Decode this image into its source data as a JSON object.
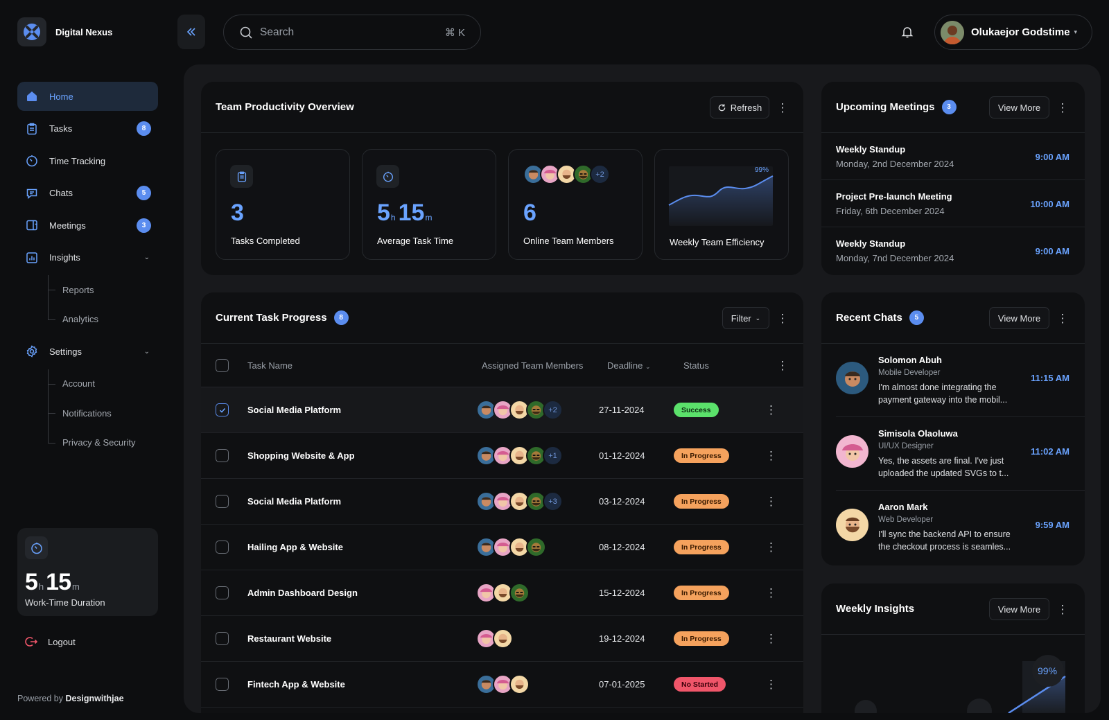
{
  "app": {
    "name": "Digital Nexus"
  },
  "sidebar": {
    "items": [
      {
        "label": "Home",
        "badge": ""
      },
      {
        "label": "Tasks",
        "badge": "8"
      },
      {
        "label": "Time Tracking",
        "badge": ""
      },
      {
        "label": "Chats",
        "badge": "5"
      },
      {
        "label": "Meetings",
        "badge": "3"
      },
      {
        "label": "Insights",
        "badge": ""
      },
      {
        "label": "Settings",
        "badge": ""
      }
    ],
    "insights_sub": [
      "Reports",
      "Analytics"
    ],
    "settings_sub": [
      "Account",
      "Notifications",
      "Privacy & Security"
    ],
    "worktime": {
      "hours": "5",
      "h_unit": "h",
      "minutes": "15",
      "m_unit": "m",
      "label": "Work-Time Duration"
    },
    "logout": "Logout",
    "powered_prefix": "Powered by ",
    "powered_brand": "Designwithjae"
  },
  "search": {
    "placeholder": "Search",
    "shortcut": "⌘ K"
  },
  "user": {
    "name": "Olukaejor Godstime"
  },
  "productivity": {
    "title": "Team Productivity Overview",
    "refresh": "Refresh",
    "stats": {
      "tasks": {
        "value": "3",
        "label": "Tasks Completed"
      },
      "avg": {
        "hours": "5",
        "h_unit": "h",
        "minutes": "15",
        "m_unit": "m",
        "label": "Average Task Time"
      },
      "online": {
        "value": "6",
        "label": "Online Team Members",
        "more": "+2"
      },
      "efficiency": {
        "label": "Weekly Team Efficiency",
        "peak": "99%"
      }
    }
  },
  "tasks": {
    "title": "Current Task Progress",
    "count": "8",
    "filter": "Filter",
    "columns": {
      "name": "Task Name",
      "members": "Assigned Team Members",
      "deadline": "Deadline",
      "status": "Status"
    },
    "rows": [
      {
        "name": "Social Media Platform",
        "members": 4,
        "more": "+2",
        "deadline": "27-11-2024",
        "status": "Success",
        "kind": "success",
        "checked": true
      },
      {
        "name": "Shopping Website & App",
        "members": 4,
        "more": "+1",
        "deadline": "01-12-2024",
        "status": "In Progress",
        "kind": "progress",
        "checked": false
      },
      {
        "name": "Social Media Platform",
        "members": 4,
        "more": "+3",
        "deadline": "03-12-2024",
        "status": "In Progress",
        "kind": "progress",
        "checked": false
      },
      {
        "name": "Hailing App & Website",
        "members": 4,
        "more": "",
        "deadline": "08-12-2024",
        "status": "In Progress",
        "kind": "progress",
        "checked": false
      },
      {
        "name": "Admin Dashboard Design",
        "members": 3,
        "more": "",
        "deadline": "15-12-2024",
        "status": "In Progress",
        "kind": "progress",
        "checked": false
      },
      {
        "name": "Restaurant Website",
        "members": 2,
        "more": "",
        "deadline": "19-12-2024",
        "status": "In Progress",
        "kind": "progress",
        "checked": false
      },
      {
        "name": "Fintech App & Website",
        "members": 3,
        "more": "",
        "deadline": "07-01-2025",
        "status": "No Started",
        "kind": "none",
        "checked": false
      }
    ]
  },
  "meetings": {
    "title": "Upcoming Meetings",
    "count": "3",
    "view_more": "View More",
    "items": [
      {
        "title": "Weekly Standup",
        "date": "Monday, 2nd December 2024",
        "time": "9:00 AM"
      },
      {
        "title": "Project Pre-launch Meeting",
        "date": "Friday, 6th December 2024",
        "time": "10:00 AM"
      },
      {
        "title": "Weekly Standup",
        "date": "Monday, 7nd December 2024",
        "time": "9:00 AM"
      }
    ]
  },
  "chats": {
    "title": "Recent Chats",
    "count": "5",
    "view_more": "View More",
    "items": [
      {
        "name": "Solomon Abuh",
        "role": "Mobile Developer",
        "message": "I'm almost done integrating the payment gateway into the mobil...",
        "time": "11:15 AM"
      },
      {
        "name": "Simisola Olaoluwa",
        "role": "UI/UX Designer",
        "message": "Yes, the assets are final. I've just uploaded the updated SVGs to t...",
        "time": "11:02 AM"
      },
      {
        "name": "Aaron Mark",
        "role": "Web Developer",
        "message": "I'll sync the backend API to ensure the checkout process is seamles...",
        "time": "9:59 AM"
      }
    ]
  },
  "insights": {
    "title": "Weekly Insights",
    "view_more": "View More",
    "peak": "99%"
  },
  "colors": {
    "accent": "#5b8def",
    "accent_text": "#6aa3ff",
    "success": "#5be16b",
    "progress": "#f5a25d",
    "not_started": "#f0566a"
  }
}
